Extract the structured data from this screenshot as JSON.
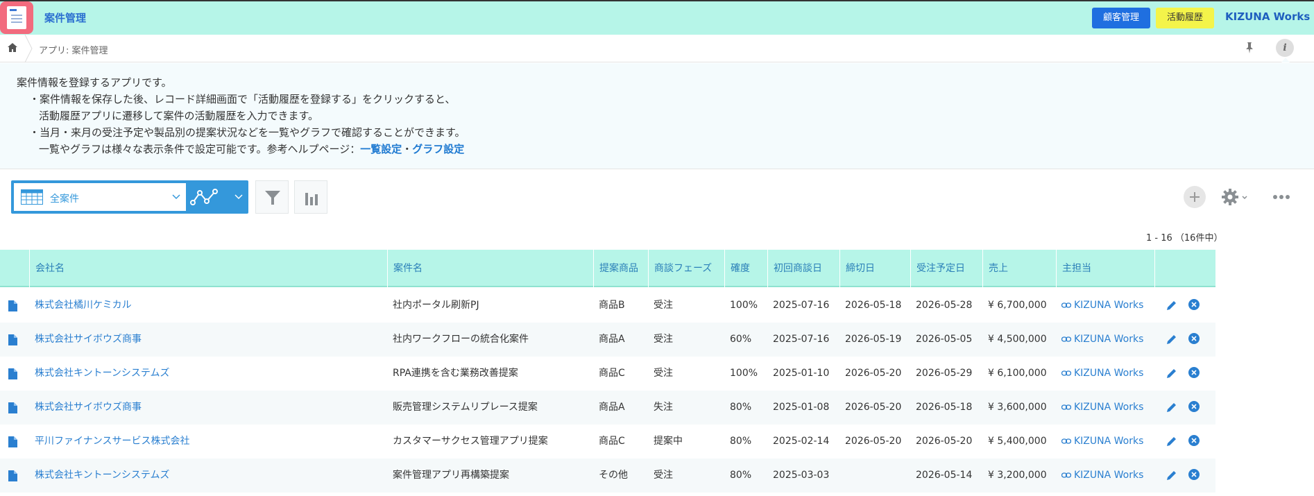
{
  "header": {
    "app_title": "案件管理",
    "customer_button": "顧客管理",
    "activity_button": "活動履歴",
    "brand": "KIZUNA Works"
  },
  "breadcrumb": {
    "path": "アプリ: 案件管理"
  },
  "description": {
    "line1": "案件情報を登録するアプリです。",
    "line2": "・案件情報を保存した後、レコード詳細画面で「活動履歴を登録する」をクリックすると、",
    "line3": "活動履歴アプリに遷移して案件の活動履歴を入力できます。",
    "line4": "・当月・来月の受注予定や製品別の提案状況などを一覧やグラフで確認することができます。",
    "line5_prefix": "一覧やグラフは様々な表示条件で設定可能です。参考ヘルプページ：",
    "link_list": "一覧設定",
    "separator": "・",
    "link_graph": "グラフ設定"
  },
  "toolbar": {
    "view_name": "全案件",
    "record_count": "1 - 16 （16件中）"
  },
  "table": {
    "headers": [
      "会社名",
      "案件名",
      "提案商品",
      "商談フェーズ",
      "確度",
      "初回商談日",
      "締切日",
      "受注予定日",
      "売上",
      "主担当"
    ],
    "rows": [
      {
        "company": "株式会社橘川ケミカル",
        "project": "社内ポータル刷新PJ",
        "product": "商品B",
        "phase": "受注",
        "probability": "100%",
        "first_meeting": "2025-07-16",
        "deadline": "2026-05-18",
        "expected_order": "2026-05-28",
        "sales": "¥ 6,700,000",
        "owner": "KIZUNA Works"
      },
      {
        "company": "株式会社サイボウズ商事",
        "project": "社内ワークフローの統合化案件",
        "product": "商品A",
        "phase": "受注",
        "probability": "60%",
        "first_meeting": "2025-07-16",
        "deadline": "2026-05-19",
        "expected_order": "2026-05-05",
        "sales": "¥ 4,500,000",
        "owner": "KIZUNA Works"
      },
      {
        "company": "株式会社キントーンシステムズ",
        "project": "RPA連携を含む業務改善提案",
        "product": "商品C",
        "phase": "受注",
        "probability": "100%",
        "first_meeting": "2025-01-10",
        "deadline": "2026-05-20",
        "expected_order": "2026-05-29",
        "sales": "¥ 6,100,000",
        "owner": "KIZUNA Works"
      },
      {
        "company": "株式会社サイボウズ商事",
        "project": "販売管理システムリプレース提案",
        "product": "商品A",
        "phase": "失注",
        "probability": "80%",
        "first_meeting": "2025-01-08",
        "deadline": "2026-05-20",
        "expected_order": "2026-05-18",
        "sales": "¥ 3,600,000",
        "owner": "KIZUNA Works"
      },
      {
        "company": "平川ファイナンスサービス株式会社",
        "project": "カスタマーサクセス管理アプリ提案",
        "product": "商品C",
        "phase": "提案中",
        "probability": "80%",
        "first_meeting": "2025-02-14",
        "deadline": "2026-05-20",
        "expected_order": "2026-05-20",
        "sales": "¥ 5,400,000",
        "owner": "KIZUNA Works"
      },
      {
        "company": "株式会社キントーンシステムズ",
        "project": "案件管理アプリ再構築提案",
        "product": "その他",
        "phase": "受注",
        "probability": "80%",
        "first_meeting": "2025-03-03",
        "deadline": "",
        "expected_order": "2026-05-14",
        "sales": "¥ 3,200,000",
        "owner": "KIZUNA Works"
      }
    ]
  },
  "colors": {
    "header_bg": "#b6f5e8",
    "accent_blue": "#3498db",
    "customer_button": "#1f6fe0",
    "activity_button": "#f4f44a",
    "app_icon": "#f26b7e",
    "link": "#2a7fd0"
  },
  "icons": {
    "home": "home-icon",
    "pin": "pin-icon",
    "info": "info-icon",
    "filter": "funnel-icon",
    "graph": "bar-chart-icon",
    "add": "plus-icon",
    "settings": "gear-icon",
    "more": "ellipsis-icon",
    "record": "document-icon",
    "edit": "pencil-icon",
    "delete": "close-circle-icon"
  }
}
